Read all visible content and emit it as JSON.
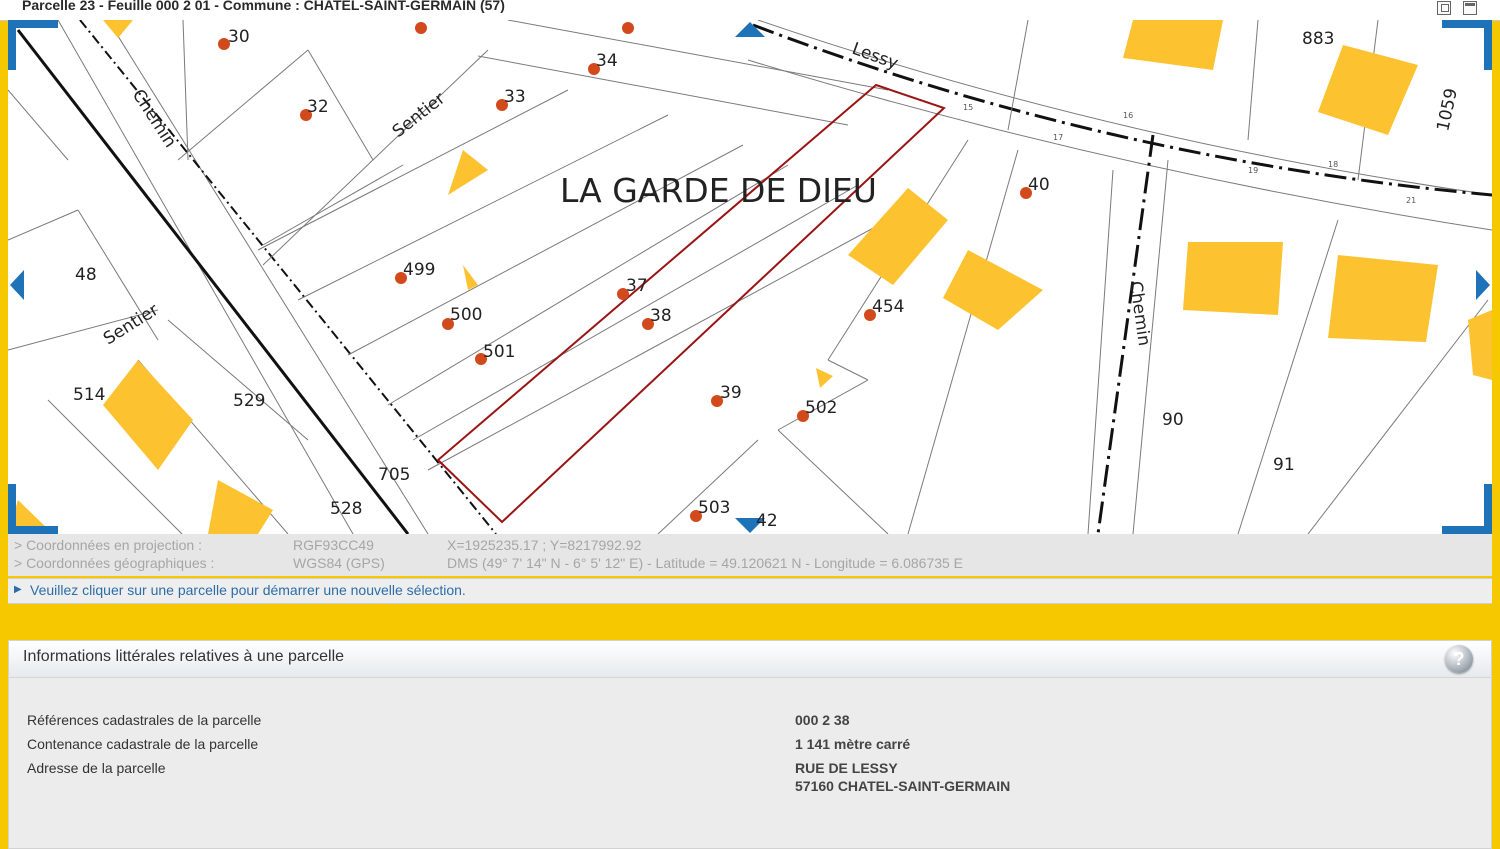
{
  "window": {
    "title": "Parcelle 23 - Feuille 000 2 01 - Commune : CHATEL-SAINT-GERMAIN (57)"
  },
  "map": {
    "locality": "LA GARDE DE DIEU",
    "roads": {
      "chemin_left": "Chemin",
      "sentier_top": "Sentier",
      "sentier_left": "Sentier",
      "lessy": "Lessy",
      "chemin_right": "Chemin"
    },
    "parcel_numbers": {
      "p30": "30",
      "p32": "32",
      "p33": "33",
      "p34": "34",
      "p37": "37",
      "p38": "38",
      "p39": "39",
      "p40": "40",
      "p48": "48",
      "p90": "90",
      "p91": "91",
      "p454": "454",
      "p499": "499",
      "p500": "500",
      "p501": "501",
      "p502": "502",
      "p503": "503",
      "p514": "514",
      "p528": "528",
      "p529": "529",
      "p705": "705",
      "p883": "883",
      "p1059": "1059",
      "p42": "42"
    },
    "road_marks": {
      "m15": "15",
      "m16": "16",
      "m17": "17",
      "m18": "18",
      "m19": "19",
      "m21": "21"
    },
    "colors": {
      "building": "#fdc22f",
      "selected_parcel": "#9b1414",
      "marker": "#d2491c",
      "nav_arrow": "#1d72b8"
    }
  },
  "coordinates": {
    "projection_label": "> Coordonnées en projection :",
    "projection_system": "RGF93CC49",
    "projection_value": "X=1925235.17 ; Y=8217992.92",
    "geo_label": "> Coordonnées géographiques :",
    "geo_system": "WGS84 (GPS)",
    "geo_value": "DMS (49° 7' 14\" N - 6° 5' 12\" E) - Latitude = 49.120621 N - Longitude = 6.086735 E"
  },
  "notice": {
    "text": "Veuillez cliquer sur une parcelle pour démarrer une nouvelle sélection."
  },
  "info_panel": {
    "title": "Informations littérales relatives à une parcelle",
    "help": "?",
    "rows": [
      {
        "label": "Références cadastrales de la parcelle",
        "value": "000 2 38"
      },
      {
        "label": "Contenance cadastrale de la parcelle",
        "value": "1 141 mètre carré"
      },
      {
        "label": "Adresse de la parcelle",
        "value": "RUE DE LESSY"
      }
    ],
    "address_line2": "57160 CHATEL-SAINT-GERMAIN"
  }
}
